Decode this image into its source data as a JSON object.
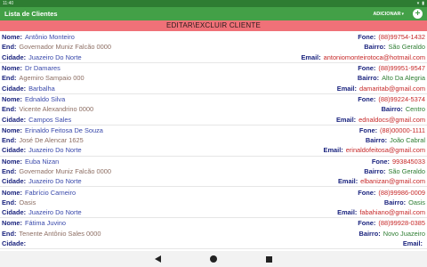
{
  "status_bar": {
    "time": "11:40",
    "icons": [
      "wifi-icon",
      "battery-icon"
    ]
  },
  "app": {
    "title": "Lista de Clientes",
    "add_label": "ADICIONAR",
    "add_caret": "▾",
    "plus_symbol": "+"
  },
  "section": {
    "header": "EDITAR\\EXCLUIR CLIENTE"
  },
  "labels": {
    "nome": "Nome:",
    "end": "End:",
    "cidade": "Cidade:",
    "fone": "Fone:",
    "bairro": "Bairro:",
    "email": "Email:"
  },
  "clients": [
    {
      "nome": "Antônio Monteiro",
      "fone": "(88)99754-1432",
      "end": "Governador Muniz Falcão 0000",
      "bairro": "São Geraldo",
      "cidade": "Juazeiro Do Norte",
      "email": "antoniomonteirotoca@hotmail.com"
    },
    {
      "nome": "Dr Damares",
      "fone": "(88)99951-9547",
      "end": "Agemiro Sampaio 000",
      "bairro": "Alto Da Alegria",
      "cidade": "Barbalha",
      "email": "damaritab@gmail.com"
    },
    {
      "nome": "Ednaldo Silva",
      "fone": "(88)99224-5374",
      "end": "Vicente Alexandrino 0000",
      "bairro": "Centro",
      "cidade": "Campos Sales",
      "email": "ednaldocs@gmail.com"
    },
    {
      "nome": "Erinaldo Feitosa De Souza",
      "fone": "(88)00000-1111",
      "end": "José De Alencar 1625",
      "bairro": "João Cabral",
      "cidade": "Juazeiro Do Norte",
      "email": "erinaldofeitosa@gmail.com"
    },
    {
      "nome": "Euba Nizan",
      "fone": "993845033",
      "end": "Governador Muniz Falcão 0000",
      "bairro": "São Geraldo",
      "cidade": "Juazeiro Do Norte",
      "email": "elbanizan@gmail.com"
    },
    {
      "nome": "Fabrício Carneiro",
      "fone": "(88)99986-0009",
      "end": "Oasis",
      "bairro": "Oasis",
      "cidade": "Juazeiro Do Norte",
      "email": "fabahiano@gmail.com"
    },
    {
      "nome": "Fátima Juvino",
      "fone": "(88)99928-0385",
      "end": "Tenente Antônio Sales 0000",
      "bairro": "Novo Juazeiro",
      "cidade": "",
      "email": ""
    }
  ],
  "colors": {
    "appbar": "#43a047",
    "status_bar": "#2e7d32",
    "section_header": "#f07178",
    "label": "#1a237e",
    "value_blue": "#3949ab",
    "value_red": "#c62828",
    "value_brown": "#8d6e63",
    "value_green": "#2e7d32"
  },
  "nav_bar": {
    "icons": [
      "back-icon",
      "home-icon",
      "recents-icon"
    ]
  }
}
